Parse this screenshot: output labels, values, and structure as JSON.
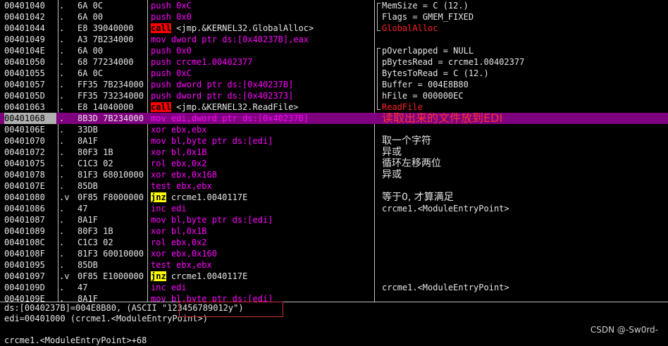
{
  "disasm_rows": [
    {
      "addr": "00401040",
      "mark": ".",
      "hex": "6A 0C",
      "mnem": "push",
      "ops": "0xC",
      "kind": "push",
      "comment": "MemSize = C (12.)",
      "comment_style": "normal"
    },
    {
      "addr": "00401042",
      "mark": ".",
      "hex": "6A 00",
      "mnem": "push",
      "ops": "0x0",
      "kind": "push",
      "comment": "Flags = GMEM_FIXED",
      "comment_style": "normal"
    },
    {
      "addr": "00401044",
      "mark": ".",
      "hex": "E8 39040000",
      "mnem": "call",
      "ops": "<jmp.&KERNEL32.GlobalAlloc>",
      "kind": "call",
      "comment": "GlobalAlloc",
      "comment_style": "red"
    },
    {
      "addr": "00401049",
      "mark": ".",
      "hex": "A3 7B234000",
      "mnem": "mov",
      "ops": "dword ptr ds:[0x40237B],eax",
      "kind": "mov",
      "comment": "",
      "comment_style": "normal"
    },
    {
      "addr": "0040104E",
      "mark": ".",
      "hex": "6A 00",
      "mnem": "push",
      "ops": "0x0",
      "kind": "push",
      "comment": "pOverlapped = NULL",
      "comment_style": "normal"
    },
    {
      "addr": "00401050",
      "mark": ".",
      "hex": "68 77234000",
      "mnem": "push",
      "ops": "crcme1.00402377",
      "kind": "push",
      "comment": "pBytesRead = crcme1.00402377",
      "comment_style": "normal"
    },
    {
      "addr": "00401055",
      "mark": ".",
      "hex": "6A 0C",
      "mnem": "push",
      "ops": "0xC",
      "kind": "push",
      "comment": "BytesToRead = C (12.)",
      "comment_style": "normal"
    },
    {
      "addr": "00401057",
      "mark": ".",
      "hex": "FF35 7B234000",
      "mnem": "push",
      "ops": "dword ptr ds:[0x40237B]",
      "kind": "push",
      "comment": "Buffer = 004E8B80",
      "comment_style": "normal"
    },
    {
      "addr": "0040105D",
      "mark": ".",
      "hex": "FF35 73234000",
      "mnem": "push",
      "ops": "dword ptr ds:[0x402373]",
      "kind": "push",
      "comment": "hFile = 000000EC",
      "comment_style": "normal"
    },
    {
      "addr": "00401063",
      "mark": ".",
      "hex": "E8 14040000",
      "mnem": "call",
      "ops": "<jmp.&KERNEL32.ReadFile>",
      "kind": "call",
      "comment": "ReadFile",
      "comment_style": "red"
    },
    {
      "addr": "00401068",
      "mark": ".",
      "hex": "8B3D 7B234000",
      "mnem": "mov",
      "ops": "edi,dword ptr ds:[0x40237B]",
      "kind": "mov",
      "comment": "读取出来的文件放到EDI",
      "comment_style": "big",
      "selected": true
    },
    {
      "addr": "0040106E",
      "mark": ".",
      "hex": "33DB",
      "mnem": "xor",
      "ops": "ebx,ebx",
      "kind": "xor",
      "comment": "",
      "comment_style": "normal"
    },
    {
      "addr": "00401070",
      "mark": ".",
      "hex": "8A1F",
      "mnem": "mov",
      "ops": "bl,byte ptr ds:[edi]",
      "kind": "mov",
      "comment": "取一个字符",
      "comment_style": "cn"
    },
    {
      "addr": "00401072",
      "mark": ".",
      "hex": "80F3 1B",
      "mnem": "xor",
      "ops": "bl,0x1B",
      "kind": "xor",
      "comment": "异或",
      "comment_style": "cn"
    },
    {
      "addr": "00401075",
      "mark": ".",
      "hex": "C1C3 02",
      "mnem": "rol",
      "ops": "ebx,0x2",
      "kind": "rol",
      "comment": "循环左移两位",
      "comment_style": "cn"
    },
    {
      "addr": "00401078",
      "mark": ".",
      "hex": "81F3 68010000",
      "mnem": "xor",
      "ops": "ebx,0x168",
      "kind": "xor",
      "comment": "异或",
      "comment_style": "cn"
    },
    {
      "addr": "0040107E",
      "mark": ".",
      "hex": "85DB",
      "mnem": "test",
      "ops": "ebx,ebx",
      "kind": "test",
      "comment": "",
      "comment_style": "normal"
    },
    {
      "addr": "00401080",
      "mark": ".v",
      "hex": "0F85 F8000000",
      "mnem": "jnz",
      "ops": "crcme1.0040117E",
      "kind": "jnz",
      "comment": "等于0, 才算满足",
      "comment_style": "cn"
    },
    {
      "addr": "00401086",
      "mark": ".",
      "hex": "47",
      "mnem": "inc",
      "ops": "edi",
      "kind": "inc",
      "comment": "crcme1.<ModuleEntryPoint>",
      "comment_style": "normal"
    },
    {
      "addr": "00401087",
      "mark": ".",
      "hex": "8A1F",
      "mnem": "mov",
      "ops": "bl,byte ptr ds:[edi]",
      "kind": "mov",
      "comment": "",
      "comment_style": "normal"
    },
    {
      "addr": "00401089",
      "mark": ".",
      "hex": "80F3 1B",
      "mnem": "xor",
      "ops": "bl,0x1B",
      "kind": "xor",
      "comment": "",
      "comment_style": "normal"
    },
    {
      "addr": "0040108C",
      "mark": ".",
      "hex": "C1C3 02",
      "mnem": "rol",
      "ops": "ebx,0x2",
      "kind": "rol",
      "comment": "",
      "comment_style": "normal"
    },
    {
      "addr": "0040108F",
      "mark": ".",
      "hex": "81F3 60010000",
      "mnem": "xor",
      "ops": "ebx,0x160",
      "kind": "xor",
      "comment": "",
      "comment_style": "normal"
    },
    {
      "addr": "00401095",
      "mark": ".",
      "hex": "85DB",
      "mnem": "test",
      "ops": "ebx,ebx",
      "kind": "test",
      "comment": "",
      "comment_style": "normal"
    },
    {
      "addr": "00401097",
      "mark": ".v",
      "hex": "0F85 E1000000",
      "mnem": "jnz",
      "ops": "crcme1.0040117E",
      "kind": "jnz",
      "comment": "",
      "comment_style": "normal"
    },
    {
      "addr": "0040109D",
      "mark": ".",
      "hex": "47",
      "mnem": "inc",
      "ops": "edi",
      "kind": "inc",
      "comment": "crcme1.<ModuleEntryPoint>",
      "comment_style": "normal"
    },
    {
      "addr": "0040109E",
      "mark": ".",
      "hex": "8A1F",
      "mnem": "mov",
      "ops": "bl,byte ptr ds:[edi]",
      "kind": "mov",
      "comment": "",
      "comment_style": "normal"
    }
  ],
  "info": {
    "line1_prefix": "ds:[0040237B]=004E8B80, (ASCII ",
    "line1_ascii": "\"123456789012y\")",
    "line2": "edi=00401000 (crcme1.<ModuleEntryPoint>)",
    "line3": "crcme1.<ModuleEntryPoint>+68"
  },
  "watermark": "CSDN @-Sw0rd-"
}
